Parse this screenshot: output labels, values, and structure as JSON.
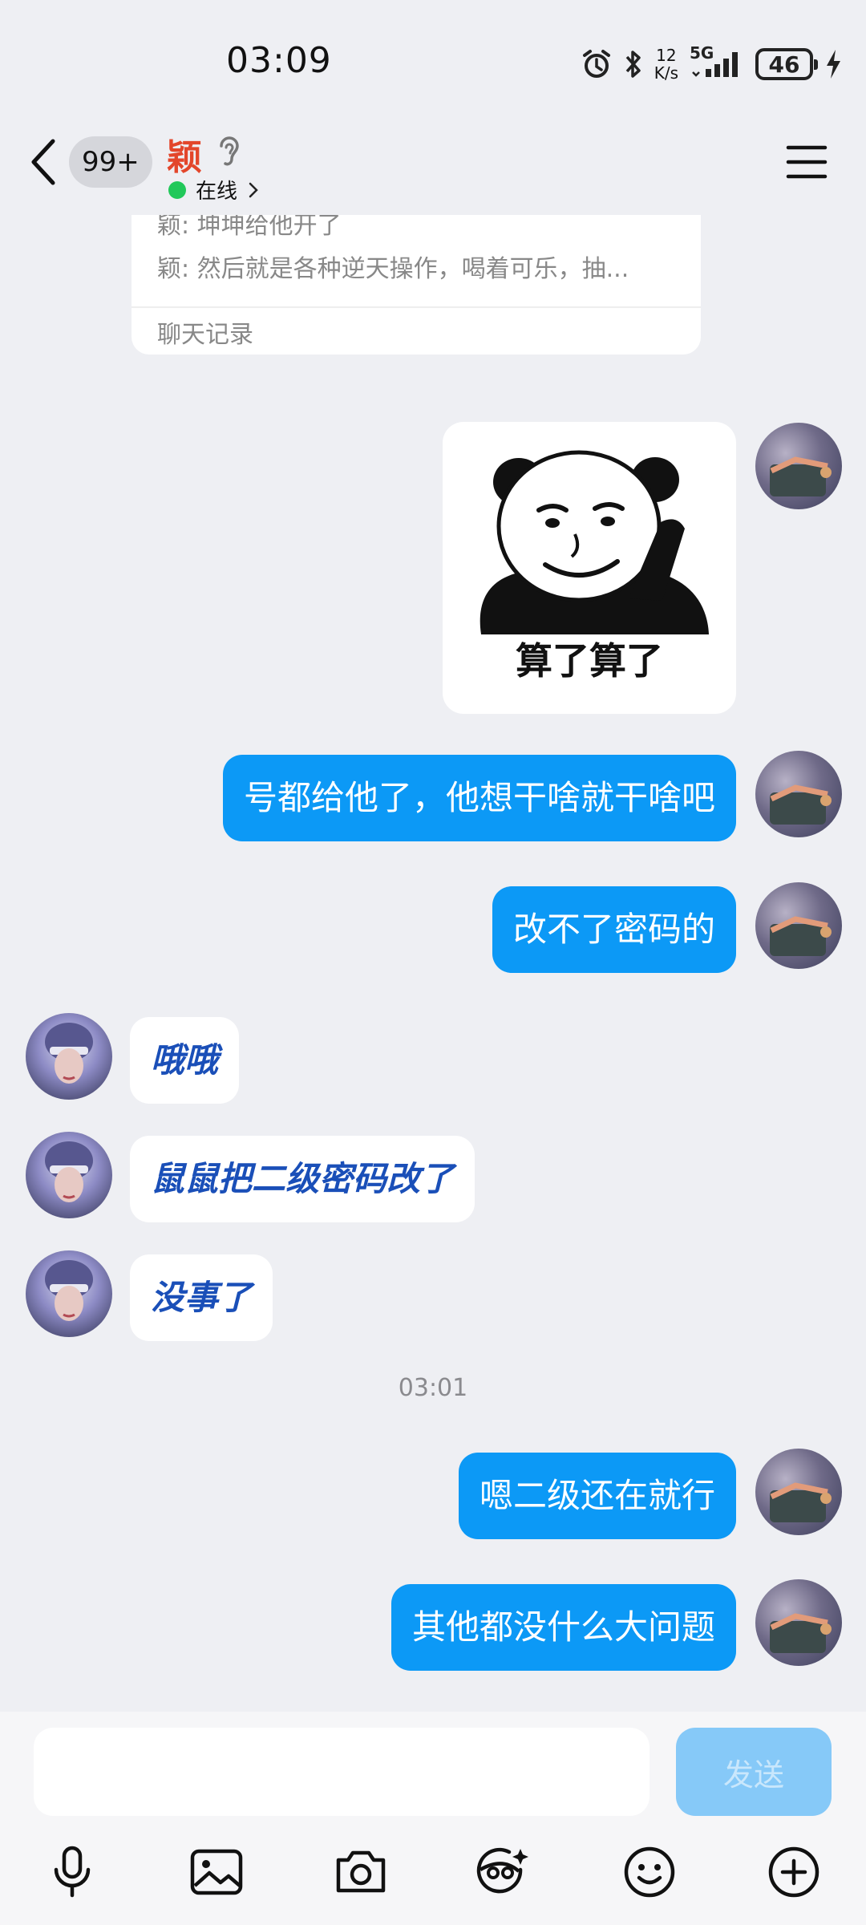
{
  "status_bar": {
    "time": "03:09",
    "net_speed_top": "12",
    "net_speed_bottom": "K/s",
    "network": "5G",
    "battery": "46"
  },
  "header": {
    "badge": "99+",
    "name": "颖",
    "status": "在线"
  },
  "forward_card": {
    "line1": "颖: 坤坤给他开了",
    "line2": "颖: 然后就是各种逆天操作，喝着可乐，抽...",
    "footer": "聊天记录"
  },
  "sticker": {
    "caption": "算了算了"
  },
  "messages": [
    {
      "from": "self",
      "text": "号都给他了，他想干啥就干啥吧"
    },
    {
      "from": "self",
      "text": "改不了密码的"
    },
    {
      "from": "other",
      "text": "哦哦"
    },
    {
      "from": "other",
      "text": "鼠鼠把二级密码改了"
    },
    {
      "from": "other",
      "text": "没事了"
    },
    {
      "from": "self",
      "text": "嗯二级还在就行"
    },
    {
      "from": "self",
      "text": "其他都没什么大问题"
    }
  ],
  "timestamp": "03:01",
  "input": {
    "placeholder": "",
    "send_label": "发送"
  },
  "colors": {
    "self_bubble": "#0c99f6",
    "other_text": "#1a4fb8",
    "name": "#e3462b",
    "online": "#21c85a"
  },
  "toolbar_icons": [
    "microphone-icon",
    "image-icon",
    "camera-icon",
    "magic-face-icon",
    "emoji-icon",
    "plus-icon"
  ]
}
